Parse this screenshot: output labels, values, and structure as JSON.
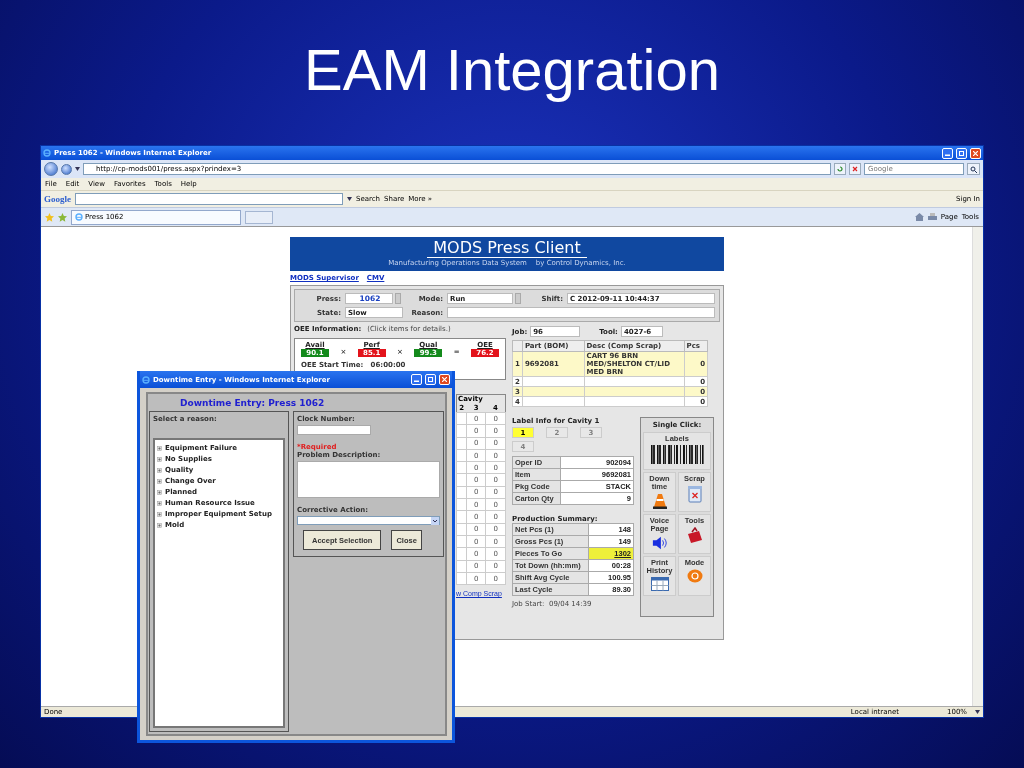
{
  "slide": {
    "title": "EAM Integration"
  },
  "browser": {
    "title": "Press 1062 - Windows Internet Explorer",
    "address": "http://cp-mods001/press.aspx?prindex=3",
    "search_placeholder": "Google",
    "menu": [
      "File",
      "Edit",
      "View",
      "Favorites",
      "Tools",
      "Help"
    ],
    "google_toolbar": {
      "logo": "Google",
      "buttons": [
        "Search",
        "Share",
        "More »"
      ],
      "sign_in": "Sign In"
    },
    "tab": {
      "label": "Press 1062"
    },
    "commands": [
      "Page",
      "Tools"
    ],
    "status_bar": {
      "text": "Done",
      "zone": "Local intranet",
      "zoom": "100%"
    }
  },
  "page": {
    "header": {
      "title": "MODS Press Client",
      "subtitle": "Manufacturing Operations Data System    by Control Dynamics, Inc."
    },
    "links": [
      "MODS Supervisor",
      "CMV"
    ],
    "fields": {
      "press_label": "Press:",
      "press": "1062",
      "mode_label": "Mode:",
      "mode": "Run",
      "shift_label": "Shift:",
      "shift": "C 2012-09-11 10:44:37",
      "state_label": "State:",
      "state": "Slow",
      "reason_label": "Reason:"
    },
    "oee": {
      "title": "OEE Information:",
      "hint": "(Click items for details.)",
      "metrics": [
        {
          "label": "Avail",
          "value": "90.1",
          "color": "#138a1b"
        },
        {
          "label": "Perf",
          "value": "85.1",
          "color": "#e3131b"
        },
        {
          "label": "Qual",
          "value": "99.3",
          "color": "#138a1b"
        },
        {
          "label": "OEE",
          "value": "76.2",
          "color": "#e3131b"
        }
      ],
      "operators": [
        "×",
        "×",
        "="
      ],
      "start_time": "OEE Start Time:   06:00:00"
    },
    "cavity": {
      "title": "Cavity",
      "columns": [
        "2",
        "3",
        "4"
      ],
      "rows": [
        [
          "",
          "0",
          "0"
        ],
        [
          "",
          "0",
          "0"
        ],
        [
          "",
          "0",
          "0"
        ],
        [
          "",
          "0",
          "0"
        ],
        [
          "",
          "0",
          "0"
        ],
        [
          "",
          "0",
          "0"
        ],
        [
          "",
          "0",
          "0"
        ],
        [
          "",
          "0",
          "0"
        ],
        [
          "",
          "0",
          "0"
        ],
        [
          "",
          "0",
          "0"
        ],
        [
          "",
          "0",
          "0"
        ],
        [
          "",
          "0",
          "0"
        ],
        [
          "",
          "0",
          "0"
        ],
        [
          "",
          "0",
          "0"
        ]
      ],
      "link": "w Comp Scrap"
    },
    "job": {
      "job_label": "Job:",
      "job": "96",
      "tool_label": "Tool:",
      "tool": "4027-6"
    },
    "bom": {
      "columns": [
        "Part (BOM)",
        "Desc (Comp Scrap)",
        "Pcs"
      ],
      "rows": [
        {
          "index": "1",
          "part": "9692081",
          "desc": "CART 96 BRN MED/SHELTON CT/LID MED BRN",
          "pcs": "0"
        },
        {
          "index": "2",
          "pcs": "0"
        },
        {
          "index": "3",
          "pcs": "0"
        },
        {
          "index": "4",
          "pcs": "0"
        }
      ]
    },
    "label_info": {
      "title": "Label Info for Cavity 1",
      "cavities": [
        {
          "label": "1",
          "selected": true
        },
        {
          "label": "2",
          "selected": false
        },
        {
          "label": "3",
          "selected": false
        },
        {
          "label": "4",
          "selected": false
        }
      ],
      "rows": [
        {
          "label": "Oper ID",
          "value": "902094"
        },
        {
          "label": "Item",
          "value": "9692081"
        },
        {
          "label": "Pkg Code",
          "value": "STACK"
        },
        {
          "label": "Carton Qty",
          "value": "9"
        }
      ]
    },
    "production": {
      "title": "Production Summary:",
      "rows": [
        {
          "label": "Net Pcs (1)",
          "value": "148",
          "highlighted": false
        },
        {
          "label": "Gross Pcs (1)",
          "value": "149",
          "highlighted": false
        },
        {
          "label": "Pieces To Go",
          "value": "1302",
          "highlighted": true
        },
        {
          "label": "Tot Down (hh:mm)",
          "value": "00:28",
          "highlighted": false
        },
        {
          "label": "Shift Avg Cycle",
          "value": "100.95",
          "highlighted": false
        },
        {
          "label": "Last Cycle",
          "value": "89.30",
          "highlighted": false
        }
      ],
      "job_start": "Job Start:  09/04 14:39"
    },
    "single_click": {
      "title": "Single Click:",
      "buttons": [
        {
          "label": "Labels",
          "kind": "barcode"
        },
        {
          "label": "Down time",
          "kind": "cone"
        },
        {
          "label": "Scrap",
          "kind": "bin"
        },
        {
          "label": "Voice Page",
          "kind": "speaker"
        },
        {
          "label": "Tools",
          "kind": "toolbox"
        },
        {
          "label": "Print History",
          "kind": "calendar"
        },
        {
          "label": "Mode",
          "kind": "dial"
        }
      ]
    }
  },
  "popup": {
    "title": "Downtime Entry - Windows Internet Explorer",
    "heading": "Downtime Entry: Press 1062",
    "reason_label": "Select a reason:",
    "reasons": [
      "Equipment Failure",
      "No Supplies",
      "Quality",
      "Change Over",
      "Planned",
      "Human Resource Issue",
      "Improper Equipment Setup",
      "Mold"
    ],
    "clock_label": "Clock Number:",
    "required": "*Required",
    "problem_label": "Problem Description:",
    "corrective_label": "Corrective Action:",
    "buttons": [
      "Accept Selection",
      "Close"
    ]
  }
}
